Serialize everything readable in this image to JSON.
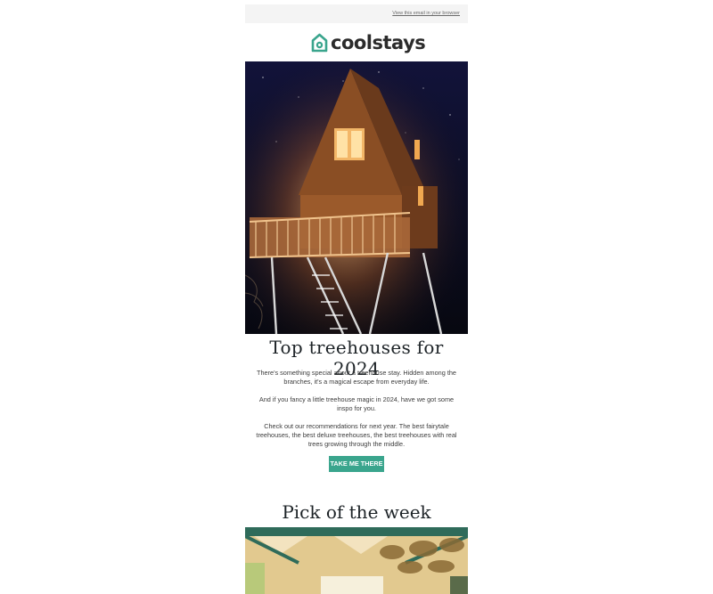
{
  "header": {
    "view_in_browser": "View this email in your browser"
  },
  "brand": {
    "name": "coolstays",
    "accent": "#3aa58d"
  },
  "hero": {
    "image": "treehouse-at-night-photo"
  },
  "article": {
    "title": "Top treehouses for 2024",
    "paragraphs": [
      "There's something special about a treehouse stay. Hidden among the branches, it's a magical escape from everyday life.",
      "And if you fancy a little treehouse magic in 2024, have we got some inspo for you.",
      "Check out our recommendations for next year. The best fairytale treehouses, the best deluxe treehouses, the best treehouses with real trees growing through the middle."
    ],
    "cta_label": "TAKE ME THERE"
  },
  "pick": {
    "title": "Pick of the week",
    "image": "treehouse-interior-photo"
  }
}
